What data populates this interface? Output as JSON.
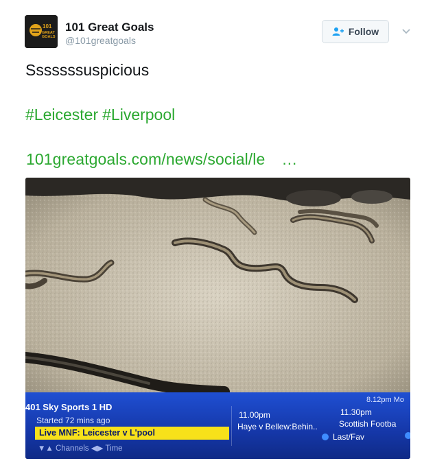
{
  "author": {
    "name": "101 Great Goals",
    "handle": "@101greatgoals",
    "avatar_text": "101 GREAT GOALS"
  },
  "follow_button": {
    "label": "Follow"
  },
  "tweet": {
    "text": "Sssssssuspicious",
    "hashtags": [
      "#Leicester",
      "#Liverpool"
    ],
    "link_text": "101greatgoals.com/news/social/le",
    "link_ellipsis": "…"
  },
  "media": {
    "tv_guide": {
      "channel": "401 Sky Sports 1 HD",
      "started": "Started 72 mins ago",
      "now_playing": "Live MNF: Leicester v L'pool",
      "nav": "▼▲ Channels ◀▶ Time",
      "clock": "8.12pm Mo",
      "slot1_time": "11.00pm",
      "slot1_program": "Haye v Bellew:Behin..",
      "slot2_time": "11.30pm",
      "slot2_program": "Scottish Footba",
      "last_fav": "Last/Fav"
    }
  },
  "colors": {
    "hashtag": "#2ba830",
    "guide_blue": "#1f4fd2",
    "highlight": "#f7e11a"
  }
}
